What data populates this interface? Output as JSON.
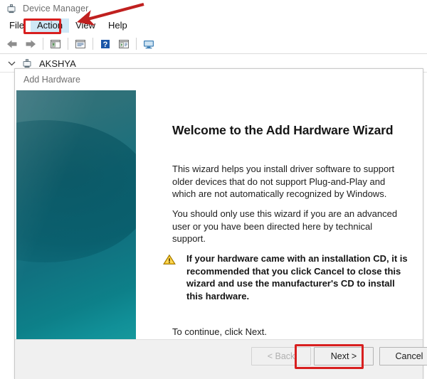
{
  "device_manager": {
    "title": "Device Manager",
    "title_icon": "device-manager-icon",
    "menu": [
      {
        "label": "File",
        "highlighted": false
      },
      {
        "label": "Action",
        "highlighted": true
      },
      {
        "label": "View",
        "highlighted": false
      },
      {
        "label": "Help",
        "highlighted": false
      }
    ],
    "toolbar": [
      {
        "icon": "back-arrow-icon",
        "name": "toolbar-back"
      },
      {
        "icon": "forward-arrow-icon",
        "name": "toolbar-forward"
      },
      {
        "icon": "show-hide-console-tree-icon",
        "name": "toolbar-console-tree"
      },
      {
        "icon": "properties-icon",
        "name": "toolbar-properties"
      },
      {
        "icon": "help-icon",
        "name": "toolbar-help"
      },
      {
        "icon": "scan-hardware-changes-icon",
        "name": "toolbar-scan-changes"
      },
      {
        "icon": "update-driver-icon",
        "name": "toolbar-update-driver"
      }
    ],
    "tree": {
      "chevron": "chevron-down-icon",
      "node_icon": "computer-icon",
      "node_label": "AKSHYA"
    }
  },
  "wizard": {
    "window_title": "Add Hardware",
    "heading": "Welcome to the Add Hardware Wizard",
    "paragraph_1": "This wizard helps you install driver software to support older devices that do not support Plug-and-Play and which are not automatically recognized by Windows.",
    "paragraph_2": "You should only use this wizard if you are an advanced user or you have been directed here by technical support.",
    "warning": {
      "icon": "warning-triangle-icon",
      "text": "If your hardware came with an installation CD, it is recommended that you click Cancel to close this wizard and use the manufacturer's CD to install this hardware."
    },
    "continue_text": "To continue, click Next.",
    "buttons": [
      {
        "label": "< Back",
        "disabled": true,
        "name": "back-button"
      },
      {
        "label": "Next >",
        "disabled": false,
        "name": "next-button"
      },
      {
        "label": "Cancel",
        "disabled": false,
        "name": "cancel-button"
      }
    ]
  },
  "annotations": {
    "highlight_color": "#d81f1f",
    "arrow": "red-arrow-annotation",
    "boxes": [
      {
        "target": "Action",
        "name": "action-menu-highlight-box"
      },
      {
        "target": "Next >",
        "name": "next-button-highlight-box"
      }
    ]
  },
  "colors": {
    "banner_top": "#35707a",
    "banner_bottom": "#16989c",
    "menu_highlight": "#cfe8f7",
    "annotation_red": "#d81f1f",
    "warning_amber": "#f0b400"
  }
}
